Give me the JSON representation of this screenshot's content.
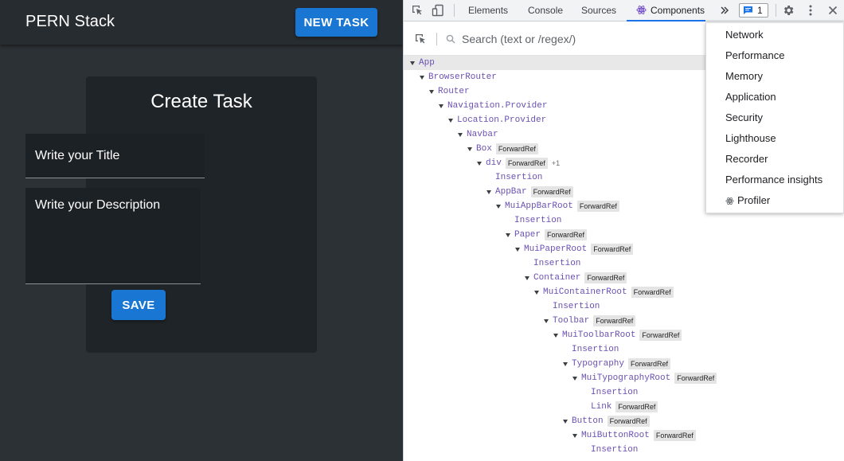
{
  "app": {
    "title": "PERN Stack",
    "new_task_label": "NEW TASK",
    "card_title": "Create Task",
    "title_placeholder": "Write your Title",
    "description_placeholder": "Write your Description",
    "save_label": "SAVE",
    "colors": {
      "accent": "#1976d2",
      "background": "#2c3135",
      "card": "#1f2428"
    }
  },
  "devtools": {
    "tabs": [
      "Elements",
      "Console",
      "Sources",
      "Components"
    ],
    "active_tab": "Components",
    "issues_count": "1",
    "search_placeholder": "Search (text or /regex/)",
    "tree": [
      {
        "name": "App",
        "depth": 0,
        "expanded": true
      },
      {
        "name": "BrowserRouter",
        "depth": 1,
        "expanded": true
      },
      {
        "name": "Router",
        "depth": 2,
        "expanded": true
      },
      {
        "name": "Navigation.Provider",
        "depth": 3,
        "expanded": true
      },
      {
        "name": "Location.Provider",
        "depth": 4,
        "expanded": true
      },
      {
        "name": "Navbar",
        "depth": 5,
        "expanded": true
      },
      {
        "name": "Box",
        "depth": 6,
        "expanded": true,
        "badge": "ForwardRef"
      },
      {
        "name": "div",
        "depth": 7,
        "expanded": true,
        "badge": "ForwardRef",
        "extra": "+1"
      },
      {
        "name": "Insertion",
        "depth": 8,
        "expanded": false
      },
      {
        "name": "AppBar",
        "depth": 8,
        "expanded": true,
        "badge": "ForwardRef"
      },
      {
        "name": "MuiAppBarRoot",
        "depth": 9,
        "expanded": true,
        "badge": "ForwardRef"
      },
      {
        "name": "Insertion",
        "depth": 10,
        "expanded": false
      },
      {
        "name": "Paper",
        "depth": 10,
        "expanded": true,
        "badge": "ForwardRef"
      },
      {
        "name": "MuiPaperRoot",
        "depth": 11,
        "expanded": true,
        "badge": "ForwardRef"
      },
      {
        "name": "Insertion",
        "depth": 12,
        "expanded": false
      },
      {
        "name": "Container",
        "depth": 12,
        "expanded": true,
        "badge": "ForwardRef"
      },
      {
        "name": "MuiContainerRoot",
        "depth": 13,
        "expanded": true,
        "badge": "ForwardRef"
      },
      {
        "name": "Insertion",
        "depth": 14,
        "expanded": false
      },
      {
        "name": "Toolbar",
        "depth": 14,
        "expanded": true,
        "badge": "ForwardRef"
      },
      {
        "name": "MuiToolbarRoot",
        "depth": 15,
        "expanded": true,
        "badge": "ForwardRef"
      },
      {
        "name": "Insertion",
        "depth": 16,
        "expanded": false
      },
      {
        "name": "Typography",
        "depth": 16,
        "expanded": true,
        "badge": "ForwardRef"
      },
      {
        "name": "MuiTypographyRoot",
        "depth": 17,
        "expanded": true,
        "badge": "ForwardRef"
      },
      {
        "name": "Insertion",
        "depth": 18,
        "expanded": false
      },
      {
        "name": "Link",
        "depth": 18,
        "expanded": false,
        "badge": "ForwardRef"
      },
      {
        "name": "Button",
        "depth": 16,
        "expanded": true,
        "badge": "ForwardRef"
      },
      {
        "name": "MuiButtonRoot",
        "depth": 17,
        "expanded": true,
        "badge": "ForwardRef"
      },
      {
        "name": "Insertion",
        "depth": 18,
        "expanded": false
      }
    ],
    "menu_items": [
      "Network",
      "Performance",
      "Memory",
      "Application",
      "Security",
      "Lighthouse",
      "Recorder",
      "Performance insights",
      "Profiler"
    ],
    "icons": [
      "inspect-element-icon",
      "device-toolbar-icon",
      "react-icon",
      "more-tabs-icon",
      "issues-icon",
      "settings-gear-icon",
      "kebab-menu-icon",
      "close-icon",
      "search-icon"
    ],
    "colors": {
      "accent": "#1a73e8",
      "node_name": "#6a51b2"
    }
  }
}
